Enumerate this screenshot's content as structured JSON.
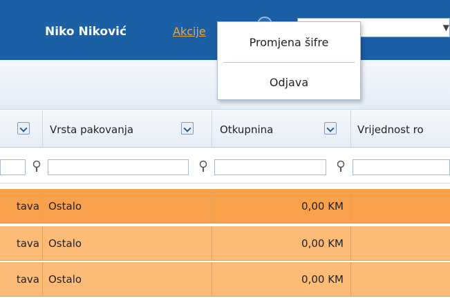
{
  "header": {
    "user_name": "Niko Niković",
    "actions_label": "Akcije",
    "select_value": ""
  },
  "columns": [
    {
      "title": "",
      "id": "prev"
    },
    {
      "title": "Vrsta pakovanja",
      "id": "vrsta"
    },
    {
      "title": "Otkupnina",
      "id": "otkupnina"
    },
    {
      "title": "Vrijednost ro",
      "id": "vrijednost"
    }
  ],
  "filters": {
    "prev": "",
    "vrsta": "",
    "otkupnina": "",
    "vrijednost": ""
  },
  "rows": [
    {
      "prev": "tava",
      "vrsta": "Ostalo",
      "otkupnina": "0,00 KM",
      "vrijednost": ""
    },
    {
      "prev": "tava",
      "vrsta": "Ostalo",
      "otkupnina": "0,00 KM",
      "vrijednost": ""
    },
    {
      "prev": "tava",
      "vrsta": "Ostalo",
      "otkupnina": "0,00 KM",
      "vrijednost": ""
    }
  ],
  "dropdown_menu": {
    "items": [
      "Promjena šifre",
      "Odjava"
    ]
  },
  "colors": {
    "header_bg": "#1b5fa5",
    "link_orange": "#f0a63a",
    "row_selected": "#f9a04b",
    "row_normal": "#fdbb78"
  }
}
